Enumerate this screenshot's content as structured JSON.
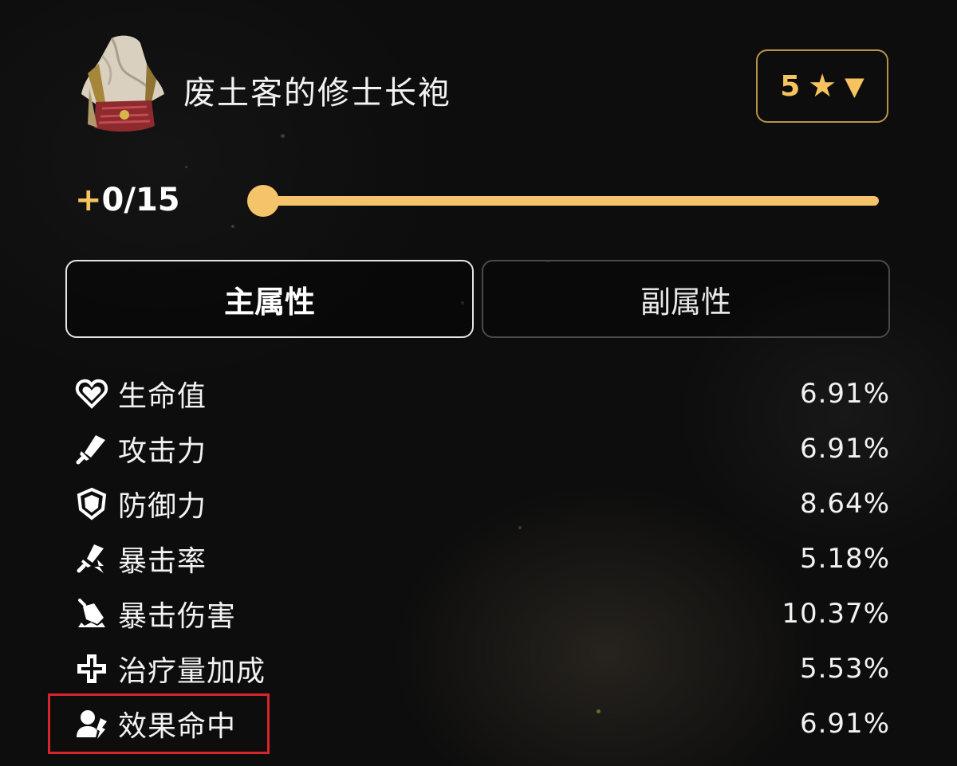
{
  "relic": {
    "name": "废土客的修士长袍",
    "icon": "relic-robe-image"
  },
  "rarity": {
    "value": "5",
    "star_icon": "★",
    "caret_icon": "▼",
    "color": "#f6c35e"
  },
  "level": {
    "plus": "+",
    "text": "0/15",
    "current": 0,
    "max": 15,
    "accent": "#f5c46a"
  },
  "tabs": [
    {
      "label": "主属性",
      "active": true
    },
    {
      "label": "副属性",
      "active": false
    }
  ],
  "stats": [
    {
      "icon": "heart-icon",
      "name": "生命值",
      "value": "6.91%"
    },
    {
      "icon": "sword-icon",
      "name": "攻击力",
      "value": "6.91%"
    },
    {
      "icon": "shield-icon",
      "name": "防御力",
      "value": "8.64%"
    },
    {
      "icon": "crit-rate-icon",
      "name": "暴击率",
      "value": "5.18%"
    },
    {
      "icon": "crit-damage-icon",
      "name": "暴击伤害",
      "value": "10.37%"
    },
    {
      "icon": "healing-cross-icon",
      "name": "治疗量加成",
      "value": "5.53%"
    },
    {
      "icon": "effect-hit-icon",
      "name": "效果命中",
      "value": "6.91%"
    }
  ],
  "highlight": {
    "color": "#d8252c",
    "target": "效果命中"
  }
}
